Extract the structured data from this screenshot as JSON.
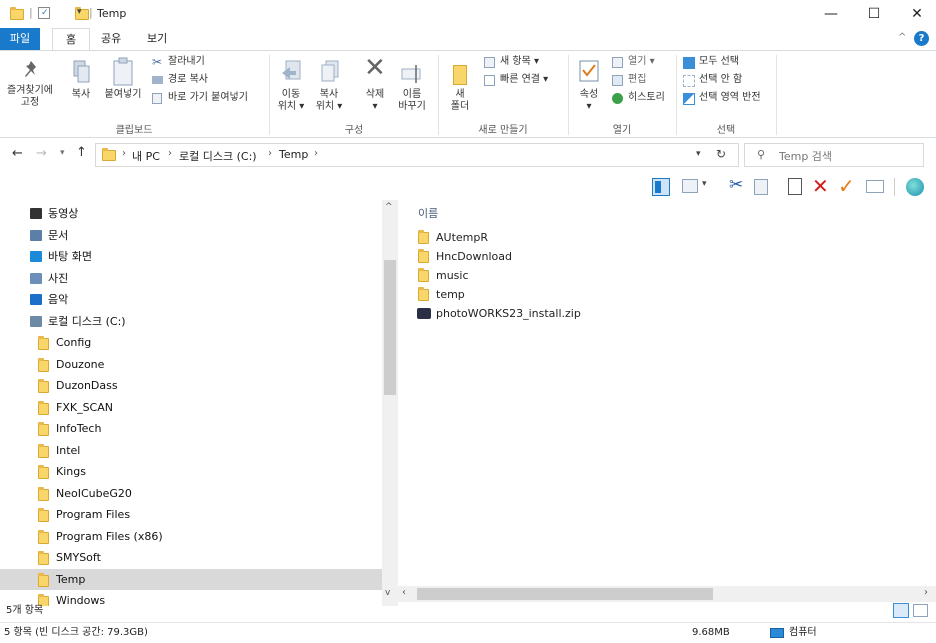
{
  "window": {
    "title": "Temp",
    "minimize": "—",
    "maximize": "☐",
    "close": "✕"
  },
  "tabs": [
    {
      "label": "파일"
    },
    {
      "label": "홈"
    },
    {
      "label": "공유"
    },
    {
      "label": "보기"
    }
  ],
  "ribbon": {
    "pin": "즐겨찾기에\n고정",
    "copy": "복사",
    "paste": "붙여넣기",
    "cut": "잘라내기",
    "copy_path": "경로 복사",
    "paste_shortcut": "바로 가기 붙여넣기",
    "group_clipboard": "클립보드",
    "move_to": "이동\n위치 ▾",
    "copy_to": "복사\n위치 ▾",
    "delete": "삭제\n▾",
    "rename": "이름\n바꾸기",
    "group_organize": "구성",
    "new_folder": "새\n폴더",
    "new_item": "새 항목 ▾",
    "easy_access": "빠른 연결 ▾",
    "group_new": "새로 만들기",
    "properties": "속성\n▾",
    "open": "열기 ▾",
    "edit": "편집",
    "history": "히스토리",
    "group_open": "열기",
    "select_all": "모두 선택",
    "select_none": "선택 안 함",
    "invert_selection": "선택 영역 반전",
    "group_select": "선택"
  },
  "address": {
    "crumbs": [
      "내 PC",
      "로컬 디스크 (C:)",
      "Temp"
    ],
    "search_placeholder": "Temp 검색"
  },
  "nav": {
    "items": [
      {
        "label": "동영상",
        "icon": "video-icon"
      },
      {
        "label": "문서",
        "icon": "document-icon"
      },
      {
        "label": "바탕 화면",
        "icon": "desktop-icon"
      },
      {
        "label": "사진",
        "icon": "picture-icon"
      },
      {
        "label": "음악",
        "icon": "music-icon"
      },
      {
        "label": "로컬 디스크 (C:)",
        "icon": "drive-icon"
      },
      {
        "label": "Config",
        "icon": "folder-icon"
      },
      {
        "label": "Douzone",
        "icon": "folder-icon"
      },
      {
        "label": "DuzonDass",
        "icon": "folder-icon"
      },
      {
        "label": "FXK_SCAN",
        "icon": "folder-icon"
      },
      {
        "label": "InfoTech",
        "icon": "folder-icon"
      },
      {
        "label": "Intel",
        "icon": "folder-icon"
      },
      {
        "label": "Kings",
        "icon": "folder-icon"
      },
      {
        "label": "NeoICubeG20",
        "icon": "folder-icon"
      },
      {
        "label": "Program Files",
        "icon": "folder-icon"
      },
      {
        "label": "Program Files (x86)",
        "icon": "folder-icon"
      },
      {
        "label": "SMYSoft",
        "icon": "folder-icon"
      },
      {
        "label": "Temp",
        "icon": "folder-icon",
        "selected": true
      },
      {
        "label": "Windows",
        "icon": "folder-icon"
      }
    ]
  },
  "content": {
    "column_name": "이름",
    "files": [
      {
        "name": "AUtempR",
        "type": "folder"
      },
      {
        "name": "HncDownload",
        "type": "folder"
      },
      {
        "name": "music",
        "type": "folder"
      },
      {
        "name": "temp",
        "type": "folder"
      },
      {
        "name": "photoWORKS23_install.zip",
        "type": "zip"
      }
    ]
  },
  "status": {
    "count": "5개 항목",
    "summary": "5 항목 (빈 디스크 공간: 79.3GB)",
    "size": "9.68MB",
    "location": "컴퓨터"
  },
  "colors": {
    "accent": "#1979ca",
    "folder": "#f8d66a",
    "selected": "#d9d9d9"
  }
}
